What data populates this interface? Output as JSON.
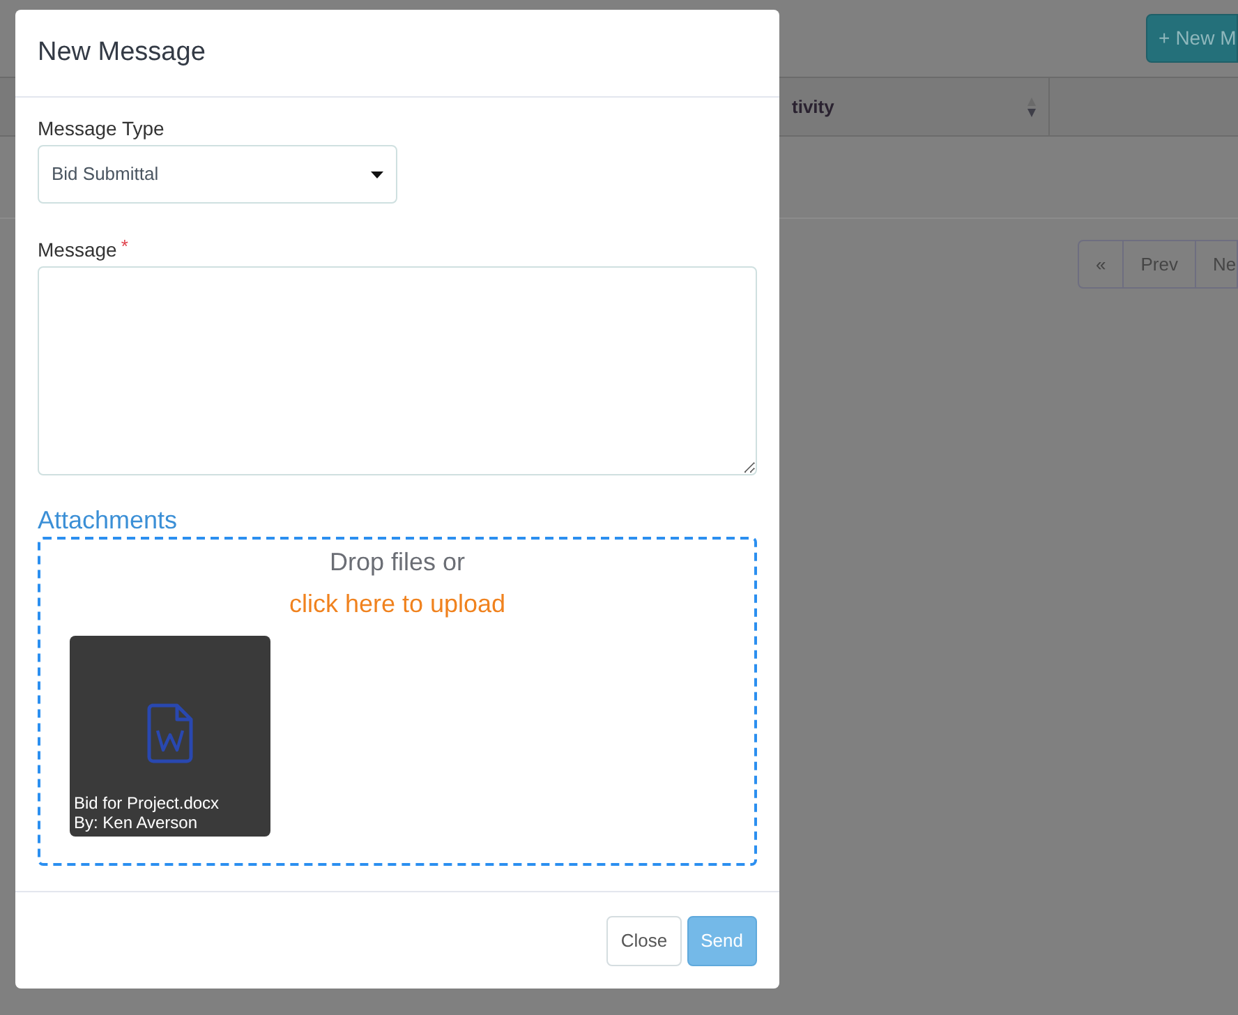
{
  "background": {
    "new_button": {
      "icon": "+",
      "label": "New M"
    },
    "table": {
      "columns": [
        {
          "label": "tivity",
          "sortable": true
        }
      ]
    },
    "pagination": [
      "«",
      "Prev",
      "Ne"
    ]
  },
  "dialog": {
    "title": "New Message",
    "message_type": {
      "label": "Message Type",
      "value": "Bid Submittal"
    },
    "message": {
      "label": "Message",
      "required_mark": "*"
    },
    "attachments": {
      "heading": "Attachments",
      "drop_text": "Drop files or",
      "upload_link": "click here to upload",
      "files": [
        {
          "name": "Bid for Project.docx",
          "author": "By: Ken Averson"
        }
      ]
    },
    "buttons": [
      {
        "label": "Close",
        "kind": "default",
        "disabled": false
      },
      {
        "label": "Send",
        "kind": "primary",
        "disabled": true
      }
    ]
  }
}
